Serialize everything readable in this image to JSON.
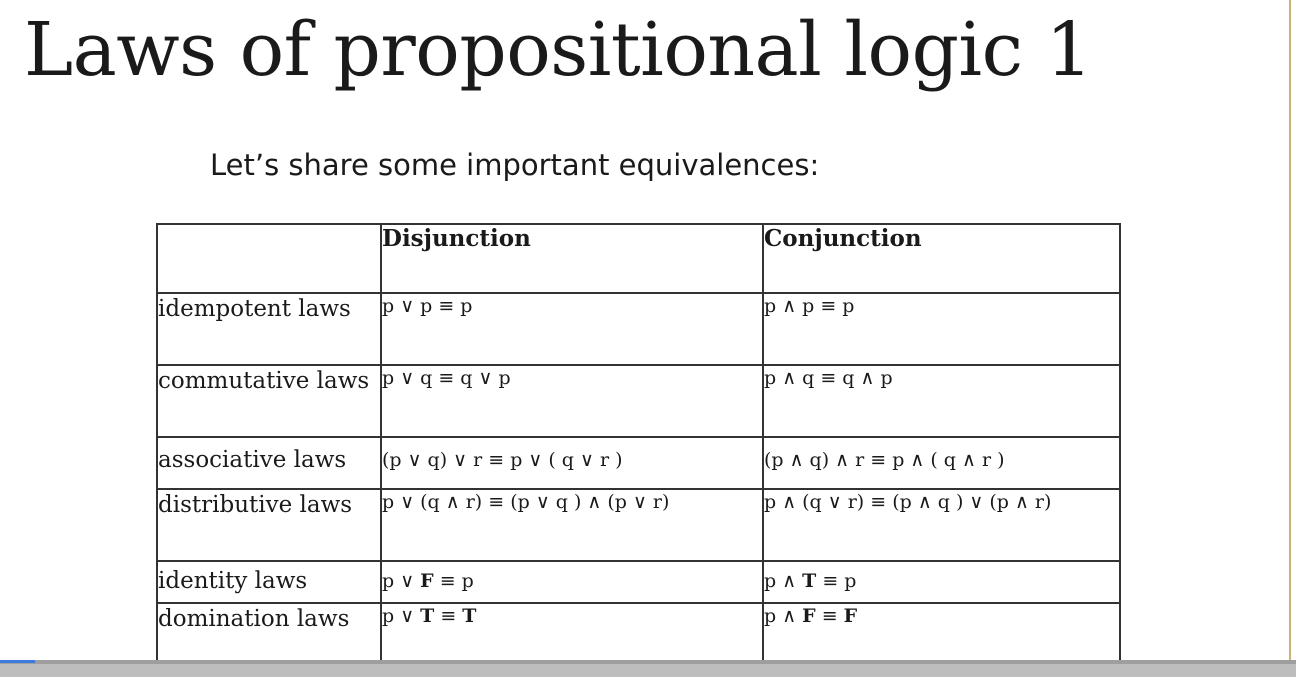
{
  "slide": {
    "title": "Laws of propositional logic 1",
    "subtitle": "Let’s share some important equivalences:"
  },
  "table": {
    "headers": [
      "",
      "Disjunction",
      "Conjunction"
    ],
    "rows": [
      {
        "name": "idempotent laws",
        "disjunction": "p ∨ p ≡ p",
        "conjunction": "p ∧ p ≡ p"
      },
      {
        "name": "commutative laws",
        "disjunction": "p ∨ q ≡ q ∨ p",
        "conjunction": "p ∧ q ≡ q ∧ p"
      },
      {
        "name": "associative laws",
        "disjunction": "(p ∨ q) ∨ r ≡ p ∨ ( q ∨ r )",
        "conjunction": "(p ∧ q) ∧ r ≡ p ∧ ( q ∧ r )"
      },
      {
        "name": "distributive laws",
        "disjunction": "p ∨ (q ∧ r) ≡ (p ∨ q ) ∧ (p ∨ r)",
        "conjunction": "p ∧ (q ∨ r) ≡ (p ∧ q ) ∨ (p ∧ r)"
      },
      {
        "name": "identity laws",
        "disjunction": [
          "p ∨ ",
          "F",
          " ≡ p"
        ],
        "conjunction": [
          "p ∧ ",
          "T",
          " ≡ p"
        ]
      },
      {
        "name": "domination laws",
        "disjunction": [
          "p ∨ ",
          "T",
          " ≡ ",
          "T"
        ],
        "conjunction": [
          "p ∧ ",
          "F",
          " ≡ ",
          "F"
        ]
      }
    ]
  },
  "player": {
    "progress_fraction": 0.027,
    "progress_color": "#3d7be0"
  }
}
